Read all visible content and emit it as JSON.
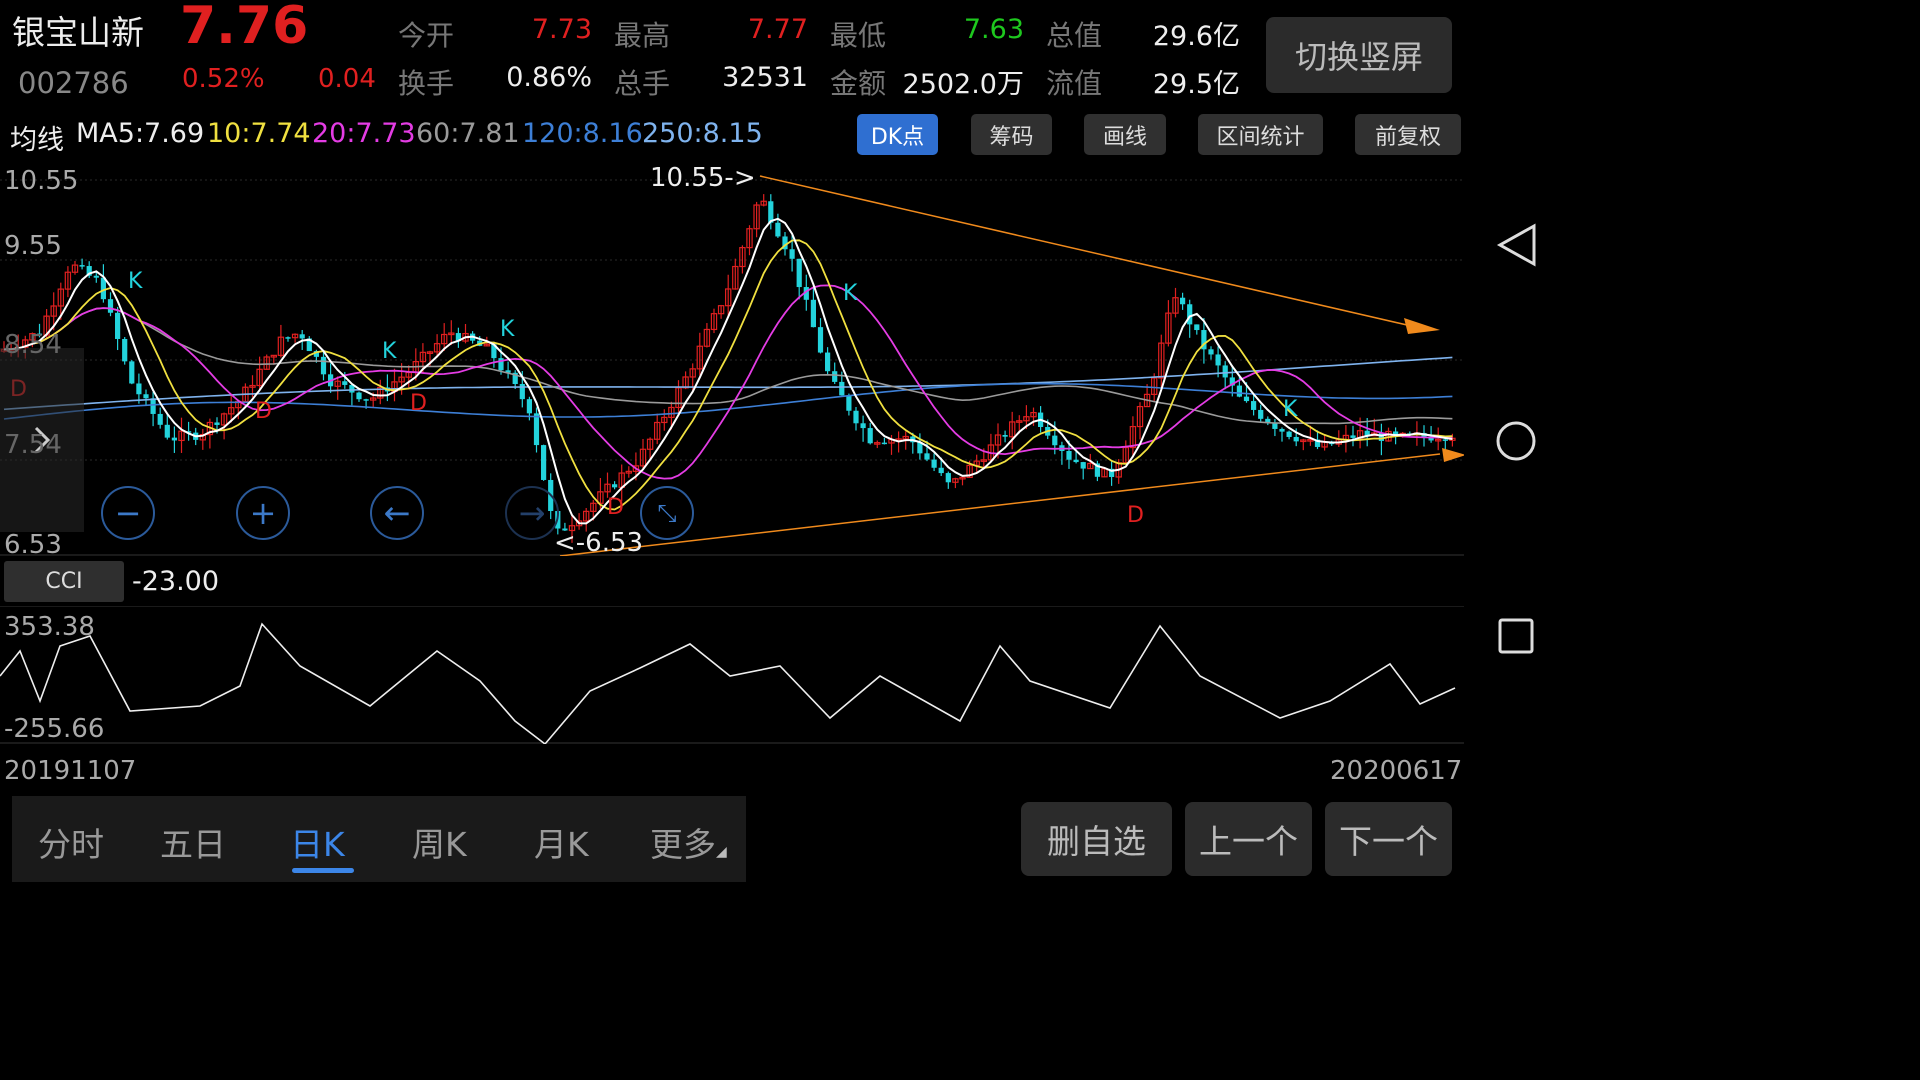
{
  "stock": {
    "name": "银宝山新",
    "code": "002786",
    "price": "7.76",
    "change_pct": "0.52%",
    "change_abs": "0.04"
  },
  "quote": {
    "open_label": "今开",
    "open": "7.73",
    "high_label": "最高",
    "high": "7.77",
    "low_label": "最低",
    "low": "7.63",
    "mcap_label": "总值",
    "mcap": "29.6亿",
    "turnover_label": "换手",
    "turnover": "0.86%",
    "volume_label": "总手",
    "volume": "32531",
    "amount_label": "金额",
    "amount": "2502.0万",
    "float_label": "流值",
    "float_mcap": "29.5亿"
  },
  "switch_button": "切换竖屏",
  "ma": {
    "label": "均线",
    "ma5": "MA5:7.69",
    "ma10": "10:7.74",
    "ma20": "20:7.73",
    "ma60": "60:7.81",
    "ma120": "120:8.16",
    "ma250": "250:8.15"
  },
  "tools": [
    "DK点",
    "筹码",
    "画线",
    "区间统计",
    "前复权"
  ],
  "main_axis": {
    "top": "10.55",
    "l2": "9.55",
    "l3": "8.54",
    "l4": "7.54",
    "bottom": "6.53"
  },
  "annotations": {
    "high_marker": "10.55->",
    "low_marker": "<-6.53",
    "k": "K",
    "d": "D"
  },
  "cci": {
    "label": "CCI",
    "value": "-23.00",
    "max": "353.38",
    "min": "-255.66"
  },
  "dates": {
    "start": "20191107",
    "end": "20200617"
  },
  "bottom_tabs": [
    "分时",
    "五日",
    "日K",
    "周K",
    "月K",
    "更多"
  ],
  "actions": [
    "删自选",
    "上一个",
    "下一个"
  ],
  "colors": {
    "up": "#e02020",
    "down": "#23d3dc",
    "ma5": "#ffffff",
    "ma10": "#f0e040",
    "ma20": "#e43ce4",
    "ma60": "#9a9a9a",
    "ma120": "#3d7fd6",
    "ma250": "#7fb3ee",
    "trend": "#f08a1c"
  },
  "chart_data": {
    "type": "candlestick",
    "ylim": [
      6.53,
      10.55
    ],
    "ma5_approx": [
      8.6,
      8.7,
      9.4,
      9.2,
      8.3,
      7.8,
      7.7,
      8.0,
      8.6,
      8.8,
      8.4,
      8.1,
      8.3,
      8.7,
      8.6,
      8.0,
      6.8,
      7.3,
      7.8,
      8.3,
      9.0,
      9.8,
      10.0,
      9.4,
      8.2,
      7.6,
      7.5,
      7.6,
      7.9,
      7.3,
      7.5,
      7.4,
      7.3,
      7.9,
      8.6,
      8.4,
      8.0,
      7.9,
      7.7,
      7.6,
      7.6
    ]
  }
}
